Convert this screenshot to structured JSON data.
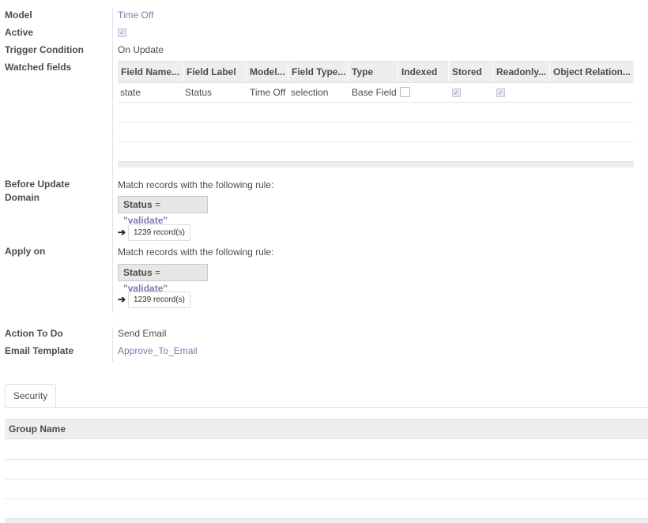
{
  "labels": {
    "model": "Model",
    "active": "Active",
    "trigger": "Trigger Condition",
    "watched": "Watched fields",
    "before_update_1": "Before Update",
    "before_update_2": "Domain",
    "apply_on": "Apply on",
    "action": "Action To Do",
    "email_template": "Email Template"
  },
  "values": {
    "model": "Time Off",
    "active": true,
    "trigger": "On Update",
    "action": "Send Email",
    "email_template": "Approve_To_Email"
  },
  "watched_table": {
    "headers": [
      "Field Name...",
      "Field Label",
      "Model...",
      "Field Type...",
      "Type",
      "Indexed",
      "Stored",
      "Readonly...",
      "Object Relation..."
    ],
    "rows": [
      {
        "name": "state",
        "label": "Status",
        "model": "Time Off",
        "field_type": "selection",
        "type": "Base Field",
        "indexed": false,
        "stored": true,
        "readonly": true,
        "relation": ""
      }
    ]
  },
  "before_update": {
    "intro": "Match records with the following rule:",
    "field": "Status",
    "op": "=",
    "value": "\"validate\"",
    "records": "1239 record(s)"
  },
  "apply_on": {
    "intro": "Match records with the following rule:",
    "field": "Status",
    "op": "=",
    "value": "\"validate\"",
    "records": "1239 record(s)"
  },
  "tabs": [
    {
      "label": "Security"
    }
  ],
  "group_table": {
    "header": "Group Name"
  },
  "icons": {
    "arrow": "arrow-right-icon",
    "checkbox": "checkbox-icon"
  },
  "colors": {
    "link": "#7c7bad",
    "header_bg": "#eeeeee"
  }
}
